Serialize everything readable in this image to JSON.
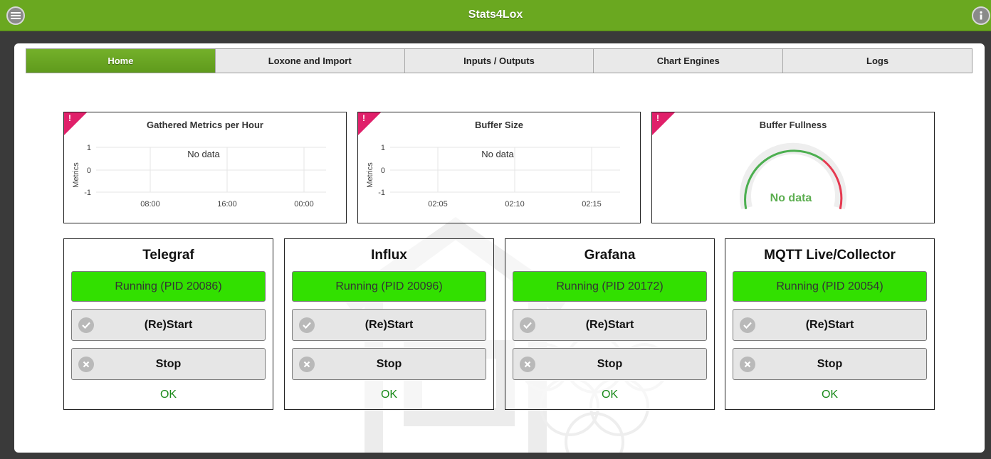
{
  "app": {
    "title": "Stats4Lox",
    "menu_icon": "menu-icon",
    "info_icon": "info-icon"
  },
  "tabs": [
    {
      "label": "Home",
      "active": true
    },
    {
      "label": "Loxone and Import",
      "active": false
    },
    {
      "label": "Inputs / Outputs",
      "active": false
    },
    {
      "label": "Chart Engines",
      "active": false
    },
    {
      "label": "Logs",
      "active": false
    }
  ],
  "charts": [
    {
      "title": "Gathered Metrics per Hour",
      "ylabel": "Metrics",
      "no_data": "No data",
      "yticks": [
        "1",
        "0",
        "-1"
      ],
      "xticks": [
        "08:00",
        "16:00",
        "00:00"
      ]
    },
    {
      "title": "Buffer Size",
      "ylabel": "Metrics",
      "no_data": "No data",
      "yticks": [
        "1",
        "0",
        "-1"
      ],
      "xticks": [
        "02:05",
        "02:10",
        "02:15"
      ]
    },
    {
      "title": "Buffer Fullness",
      "no_data": "No data"
    }
  ],
  "chart_data": [
    {
      "type": "line",
      "title": "Gathered Metrics per Hour",
      "ylabel": "Metrics",
      "ylim": [
        -1,
        1
      ],
      "x": [
        "08:00",
        "16:00",
        "00:00"
      ],
      "series": [],
      "grid": true
    },
    {
      "type": "line",
      "title": "Buffer Size",
      "ylabel": "Metrics",
      "ylim": [
        -1,
        1
      ],
      "x": [
        "02:05",
        "02:10",
        "02:15"
      ],
      "series": [],
      "grid": true
    }
  ],
  "services": [
    {
      "name": "Telegraf",
      "status": "Running (PID 20086)",
      "restart": "(Re)Start",
      "stop": "Stop",
      "result": "OK"
    },
    {
      "name": "Influx",
      "status": "Running (PID 20096)",
      "restart": "(Re)Start",
      "stop": "Stop",
      "result": "OK"
    },
    {
      "name": "Grafana",
      "status": "Running (PID 20172)",
      "restart": "(Re)Start",
      "stop": "Stop",
      "result": "OK"
    },
    {
      "name": "MQTT Live/Collector",
      "status": "Running (PID 20054)",
      "restart": "(Re)Start",
      "stop": "Stop",
      "result": "OK"
    }
  ],
  "colors": {
    "header": "#6aa820",
    "status_running": "#32e000",
    "alert_flag": "#e0206a",
    "gauge_green": "#4caf50",
    "gauge_red": "#e53950",
    "ok_text": "#1a8a1a"
  }
}
